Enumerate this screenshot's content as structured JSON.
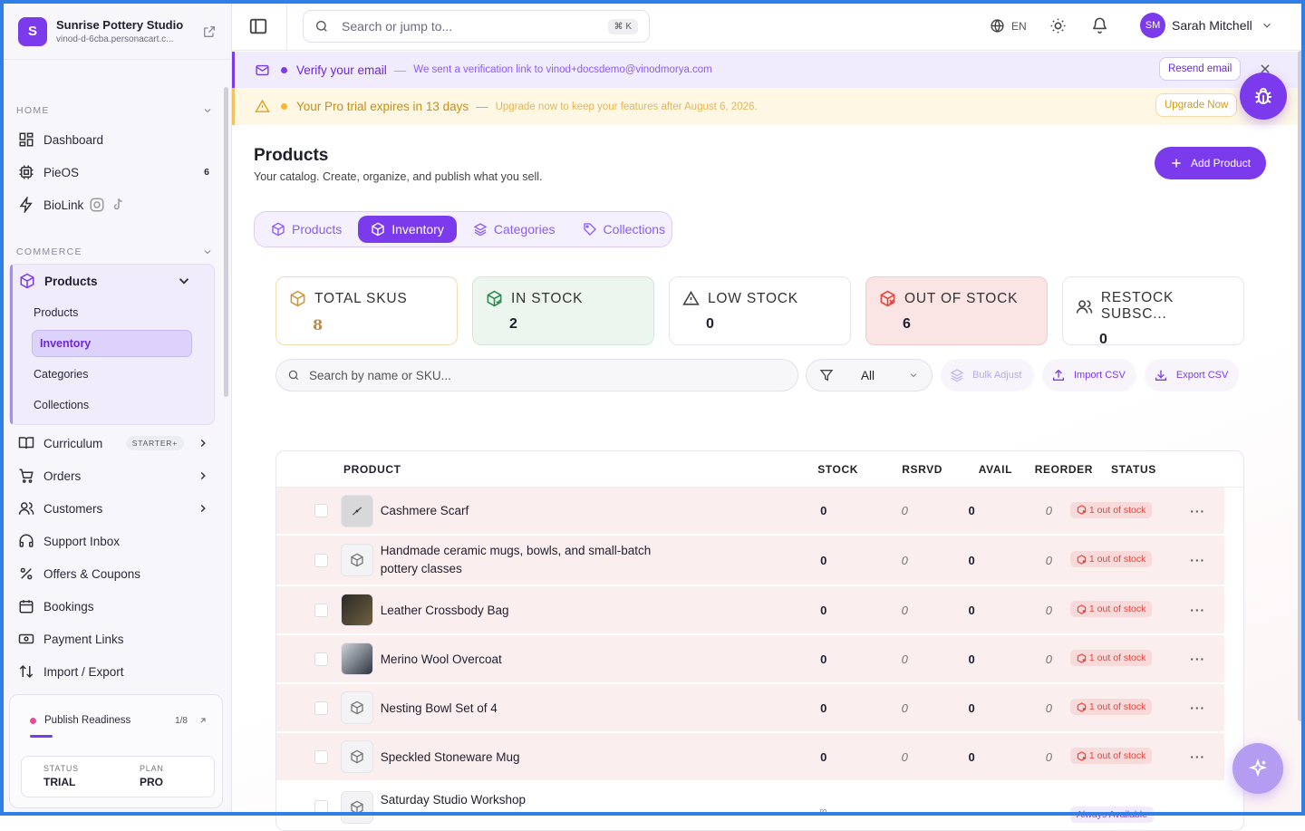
{
  "store": {
    "initial": "S",
    "name": "Sunrise Pottery Studio",
    "url": "vinod-d-6cba.personacart.c..."
  },
  "sidebar": {
    "home_label": "HOME",
    "home_items": [
      {
        "label": "Dashboard"
      },
      {
        "label": "PieOS",
        "badge": "6"
      },
      {
        "label": "BioLink"
      }
    ],
    "commerce_label": "COMMERCE",
    "products_group": {
      "label": "Products",
      "sub": [
        "Products",
        "Inventory",
        "Categories",
        "Collections"
      ]
    },
    "commerce_items": [
      {
        "label": "Curriculum",
        "tag": "STARTER+"
      },
      {
        "label": "Orders"
      },
      {
        "label": "Customers"
      },
      {
        "label": "Support Inbox"
      },
      {
        "label": "Offers & Coupons"
      },
      {
        "label": "Bookings"
      },
      {
        "label": "Payment Links"
      },
      {
        "label": "Import / Export"
      }
    ],
    "readiness": {
      "label": "Publish Readiness",
      "count": "1/8",
      "status_label": "STATUS",
      "status_value": "TRIAL",
      "plan_label": "PLAN",
      "plan_value": "PRO"
    }
  },
  "topbar": {
    "search_placeholder": "Search or jump to...",
    "shortcut": "⌘ K",
    "lang": "EN",
    "user_initials": "SM",
    "user_name": "Sarah Mitchell"
  },
  "banners": {
    "email": {
      "title": "Verify your email",
      "message": "We sent a verification link to vinod+docsdemo@vinodmorya.com",
      "button": "Resend email",
      "accent": "#7c3aed"
    },
    "trial": {
      "title": "Your Pro trial expires in 13 days",
      "message": "Upgrade now to keep your features after August 6, 2026.",
      "button": "Upgrade Now",
      "accent": "#f4c15d"
    }
  },
  "page": {
    "title": "Products",
    "subtitle": "Your catalog. Create, organize, and publish what you sell.",
    "add_button": "Add Product",
    "tabs": [
      "Products",
      "Inventory",
      "Categories",
      "Collections"
    ],
    "active_tab": "Inventory"
  },
  "stats": [
    {
      "label": "TOTAL SKUS",
      "value": "8"
    },
    {
      "label": "IN STOCK",
      "value": "2"
    },
    {
      "label": "LOW STOCK",
      "value": "0"
    },
    {
      "label": "OUT OF STOCK",
      "value": "6"
    },
    {
      "label": "RESTOCK SUBSC...",
      "value": "0"
    }
  ],
  "filters": {
    "search_placeholder": "Search by name or SKU...",
    "select_value": "All",
    "bulk": "Bulk Adjust",
    "import": "Import CSV",
    "export": "Export CSV"
  },
  "table": {
    "columns": [
      "PRODUCT",
      "STOCK",
      "RSRVD",
      "AVAIL",
      "REORDER",
      "STATUS"
    ],
    "rows": [
      {
        "name": "Cashmere Scarf",
        "stock": "0",
        "rsrvd": "0",
        "avail": "0",
        "reorder": "0",
        "status": "1 out of stock",
        "thumb": "photo"
      },
      {
        "name": "Handmade ceramic mugs, bowls, and small-batch pottery classes",
        "stock": "0",
        "rsrvd": "0",
        "avail": "0",
        "reorder": "0",
        "status": "1 out of stock",
        "thumb": "box-icon"
      },
      {
        "name": "Leather Crossbody Bag",
        "stock": "0",
        "rsrvd": "0",
        "avail": "0",
        "reorder": "0",
        "status": "1 out of stock",
        "thumb": "photo"
      },
      {
        "name": "Merino Wool Overcoat",
        "stock": "0",
        "rsrvd": "0",
        "avail": "0",
        "reorder": "0",
        "status": "1 out of stock",
        "thumb": "photo"
      },
      {
        "name": "Nesting Bowl Set of 4",
        "stock": "0",
        "rsrvd": "0",
        "avail": "0",
        "reorder": "0",
        "status": "1 out of stock",
        "thumb": "box-icon"
      },
      {
        "name": "Speckled Stoneware Mug",
        "stock": "0",
        "rsrvd": "0",
        "avail": "0",
        "reorder": "0",
        "status": "1 out of stock",
        "thumb": "box-icon"
      },
      {
        "name": "Saturday Studio Workshop",
        "stock": "∞",
        "rsrvd": "—",
        "avail": "—",
        "reorder": "—",
        "status": "Always Available",
        "thumb": "box-icon"
      }
    ],
    "more": "···"
  },
  "colors": {
    "brand": "#7c3aed",
    "danger": "#e0453b",
    "instock_bg": "#ecf6ef",
    "outstock_bg": "#fbe4e4"
  }
}
